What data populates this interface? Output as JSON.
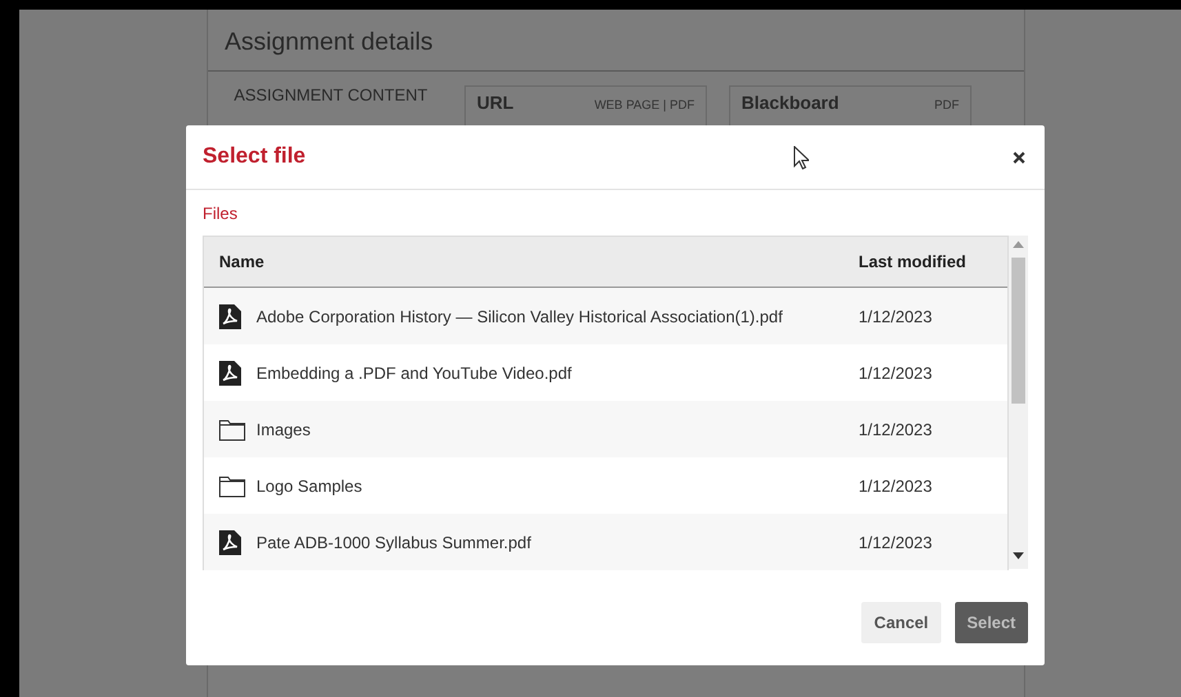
{
  "page": {
    "title": "Assignment details",
    "content_label": "ASSIGNMENT CONTENT",
    "sources": [
      {
        "name": "URL",
        "types": "WEB PAGE | PDF"
      },
      {
        "name": "Blackboard",
        "types": "PDF"
      }
    ]
  },
  "dialog": {
    "title": "Select file",
    "breadcrumb": "Files",
    "table": {
      "columns": [
        "Name",
        "Last modified"
      ],
      "rows": [
        {
          "kind": "pdf",
          "name": "Adobe Corporation History — Silicon Valley Historical Association(1).pdf",
          "modified": "1/12/2023"
        },
        {
          "kind": "pdf",
          "name": "Embedding a .PDF and YouTube Video.pdf",
          "modified": "1/12/2023"
        },
        {
          "kind": "folder",
          "name": "Images",
          "modified": "1/12/2023"
        },
        {
          "kind": "folder",
          "name": "Logo Samples",
          "modified": "1/12/2023"
        },
        {
          "kind": "pdf",
          "name": "Pate ADB-1000 Syllabus Summer.pdf",
          "modified": "1/12/2023"
        }
      ]
    },
    "buttons": [
      {
        "label": "Cancel",
        "disabled": false
      },
      {
        "label": "Select",
        "disabled": true
      }
    ]
  }
}
